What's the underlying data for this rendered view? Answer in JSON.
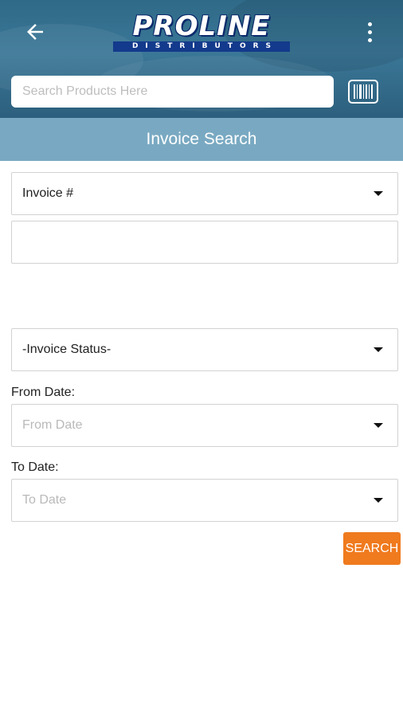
{
  "header": {
    "logo_main": "PROLINE",
    "logo_sub": "DISTRIBUTORS",
    "search_placeholder": "Search Products Here"
  },
  "page_title": "Invoice Search",
  "form": {
    "search_type": "Invoice #",
    "search_value": "",
    "invoice_status": "-Invoice Status-",
    "from_date_label": "From Date:",
    "from_date_placeholder": "From Date",
    "to_date_label": "To Date:",
    "to_date_placeholder": "To Date",
    "search_button": "SEARCH"
  },
  "colors": {
    "header": "#356f8e",
    "title_bar": "#79a9c2",
    "search_button": "#f07a1e"
  },
  "icons": {
    "back": "back-arrow-icon",
    "menu": "more-vert-icon",
    "barcode": "barcode-icon",
    "dropdown": "caret-down-icon"
  }
}
